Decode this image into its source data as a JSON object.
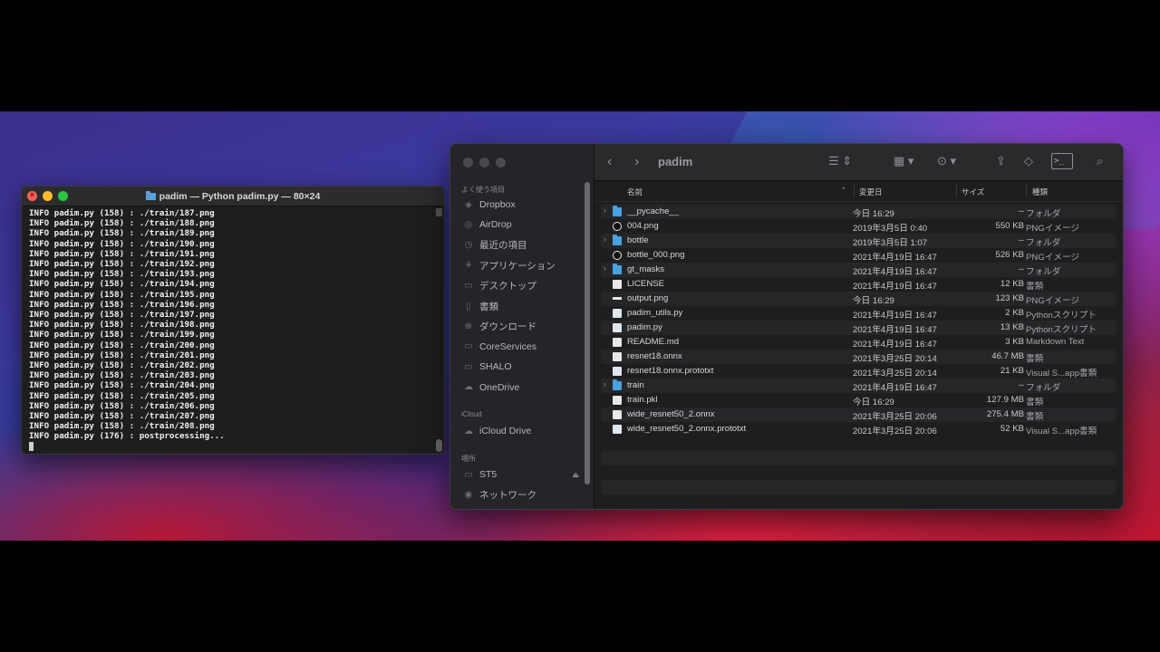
{
  "terminal": {
    "title": "padim — Python padim.py — 80×24",
    "lines": [
      "INFO padim.py (158) : ./train/187.png",
      "INFO padim.py (158) : ./train/188.png",
      "INFO padim.py (158) : ./train/189.png",
      "INFO padim.py (158) : ./train/190.png",
      "INFO padim.py (158) : ./train/191.png",
      "INFO padim.py (158) : ./train/192.png",
      "INFO padim.py (158) : ./train/193.png",
      "INFO padim.py (158) : ./train/194.png",
      "INFO padim.py (158) : ./train/195.png",
      "INFO padim.py (158) : ./train/196.png",
      "INFO padim.py (158) : ./train/197.png",
      "INFO padim.py (158) : ./train/198.png",
      "INFO padim.py (158) : ./train/199.png",
      "INFO padim.py (158) : ./train/200.png",
      "INFO padim.py (158) : ./train/201.png",
      "INFO padim.py (158) : ./train/202.png",
      "INFO padim.py (158) : ./train/203.png",
      "INFO padim.py (158) : ./train/204.png",
      "INFO padim.py (158) : ./train/205.png",
      "INFO padim.py (158) : ./train/206.png",
      "INFO padim.py (158) : ./train/207.png",
      "INFO padim.py (158) : ./train/208.png",
      "INFO padim.py (176) : postprocessing..."
    ]
  },
  "finder": {
    "title": "padim",
    "sidebar": {
      "favorites_header": "よく使う項目",
      "favorites": [
        {
          "label": "Dropbox",
          "icon": "dropbox-icon"
        },
        {
          "label": "AirDrop",
          "icon": "airdrop-icon"
        },
        {
          "label": "最近の項目",
          "icon": "clock-icon"
        },
        {
          "label": "アプリケーション",
          "icon": "applications-icon"
        },
        {
          "label": "デスクトップ",
          "icon": "desktop-icon"
        },
        {
          "label": "書類",
          "icon": "document-icon"
        },
        {
          "label": "ダウンロード",
          "icon": "download-icon"
        },
        {
          "label": "CoreServices",
          "icon": "folder-icon"
        },
        {
          "label": "SHALO",
          "icon": "folder-icon"
        },
        {
          "label": "OneDrive",
          "icon": "cloud-icon"
        }
      ],
      "icloud_header": "iCloud",
      "icloud": [
        {
          "label": "iCloud Drive",
          "icon": "cloud-icon"
        }
      ],
      "locations_header": "場所",
      "locations": [
        {
          "label": "ST5",
          "icon": "drive-icon"
        },
        {
          "label": "ネットワーク",
          "icon": "network-icon"
        }
      ]
    },
    "columns": {
      "name": "名前",
      "date": "変更日",
      "size": "サイズ",
      "kind": "種類"
    },
    "files": [
      {
        "name": "__pycache__",
        "date": "今日 16:29",
        "size": "--",
        "kind": "フォルダ",
        "type": "folder",
        "expandable": true
      },
      {
        "name": "004.png",
        "date": "2019年3月5日 0:40",
        "size": "550 KB",
        "kind": "PNGイメージ",
        "type": "image",
        "expandable": false
      },
      {
        "name": "bottle",
        "date": "2019年3月5日 1:07",
        "size": "--",
        "kind": "フォルダ",
        "type": "folder",
        "expandable": true
      },
      {
        "name": "bottle_000.png",
        "date": "2021年4月19日 16:47",
        "size": "526 KB",
        "kind": "PNGイメージ",
        "type": "image",
        "expandable": false
      },
      {
        "name": "gt_masks",
        "date": "2021年4月19日 16:47",
        "size": "--",
        "kind": "フォルダ",
        "type": "folder",
        "expandable": true
      },
      {
        "name": "LICENSE",
        "date": "2021年4月19日 16:47",
        "size": "12 KB",
        "kind": "書類",
        "type": "doc",
        "expandable": false
      },
      {
        "name": "output.png",
        "date": "今日 16:29",
        "size": "123 KB",
        "kind": "PNGイメージ",
        "type": "line",
        "expandable": false
      },
      {
        "name": "padim_utils.py",
        "date": "2021年4月19日 16:47",
        "size": "2 KB",
        "kind": "Pythonスクリプト",
        "type": "py",
        "expandable": false
      },
      {
        "name": "padim.py",
        "date": "2021年4月19日 16:47",
        "size": "13 KB",
        "kind": "Pythonスクリプト",
        "type": "py",
        "expandable": false
      },
      {
        "name": "README.md",
        "date": "2021年4月19日 16:47",
        "size": "3 KB",
        "kind": "Markdown Text",
        "type": "doc",
        "expandable": false
      },
      {
        "name": "resnet18.onnx",
        "date": "2021年3月25日 20:14",
        "size": "46.7 MB",
        "kind": "書類",
        "type": "doc",
        "expandable": false
      },
      {
        "name": "resnet18.onnx.prototxt",
        "date": "2021年3月25日 20:14",
        "size": "21 KB",
        "kind": "Visual S...app書類",
        "type": "py",
        "expandable": false
      },
      {
        "name": "train",
        "date": "2021年4月19日 16:47",
        "size": "--",
        "kind": "フォルダ",
        "type": "folder",
        "expandable": true
      },
      {
        "name": "train.pkl",
        "date": "今日 16:29",
        "size": "127.9 MB",
        "kind": "書類",
        "type": "doc",
        "expandable": false
      },
      {
        "name": "wide_resnet50_2.onnx",
        "date": "2021年3月25日 20:06",
        "size": "275.4 MB",
        "kind": "書類",
        "type": "doc",
        "expandable": false
      },
      {
        "name": "wide_resnet50_2.onnx.prototxt",
        "date": "2021年3月25日 20:06",
        "size": "52 KB",
        "kind": "Visual S...app書類",
        "type": "py",
        "expandable": false
      }
    ]
  }
}
